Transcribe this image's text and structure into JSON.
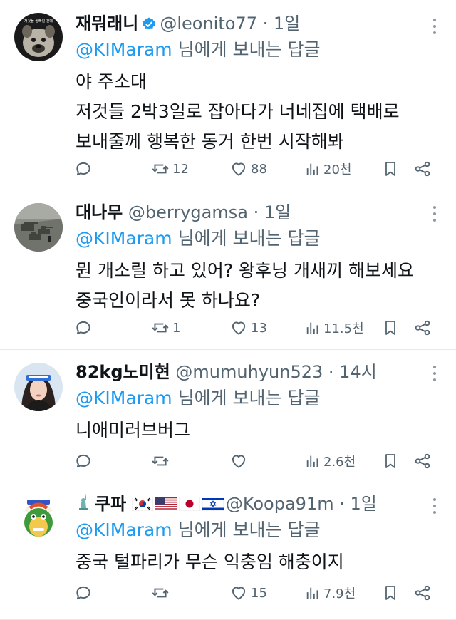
{
  "tweets": [
    {
      "name": "재뭐래니",
      "verified": true,
      "handle": "@leonito77",
      "sep": "·",
      "time": "1일",
      "reply_to": "@KIMaram",
      "reply_suffix": "님에게 보내는 답글",
      "lines": [
        "야 주소대",
        "저것들 2박3일로 잡아다가 너네집에 택배로",
        "보내줄께 행복한 동거 한번 시작해봐"
      ],
      "replies": "",
      "retweets": "12",
      "likes": "88",
      "views": "20천",
      "avatar_icon": "bulldog-avatar-icon",
      "avatar_caption": "저것들 꿀빠일 건데"
    },
    {
      "name": "대나무",
      "verified": false,
      "handle": "@berrygamsa",
      "sep": "·",
      "time": "1일",
      "reply_to": "@KIMaram",
      "reply_suffix": "님에게 보내는 답글",
      "lines": [
        "뭔 개소릴 하고 있어? 왕후닝 개새끼 해보세요",
        "중국인이라서 못 하나요?"
      ],
      "replies": "",
      "retweets": "1",
      "likes": "13",
      "views": "11.5천",
      "avatar_icon": "tank-photo-avatar-icon"
    },
    {
      "name": "82kg노미현",
      "verified": false,
      "handle": "@mumuhyun523",
      "sep": "·",
      "time": "14시",
      "reply_to": "@KIMaram",
      "reply_suffix": "님에게 보내는 답글",
      "lines": [
        "니애미러브버그"
      ],
      "replies": "",
      "retweets": "",
      "likes": "",
      "views": "2.6천",
      "avatar_icon": "woman-photo-avatar-icon"
    },
    {
      "name": "쿠파",
      "verified": false,
      "handle": "@Koopa91m",
      "sep": "·",
      "time": "1일",
      "reply_to": "@KIMaram",
      "reply_suffix": "님에게 보내는 답글",
      "lines": [
        "중국 털파리가 무슨 익충임 해충이지"
      ],
      "replies": "",
      "retweets": "",
      "likes": "15",
      "views": "7.9천",
      "avatar_icon": "bowser-avatar-icon",
      "flags": [
        "statue-of-liberty-icon",
        "korea-flag-icon",
        "usa-flag-icon",
        "japan-flag-icon",
        "israel-flag-icon"
      ]
    }
  ],
  "colors": {
    "link": "#1d9bf0",
    "muted": "#536471",
    "text": "#0f1419",
    "divider": "#e6e9ec",
    "verified": "#1d9bf0"
  }
}
